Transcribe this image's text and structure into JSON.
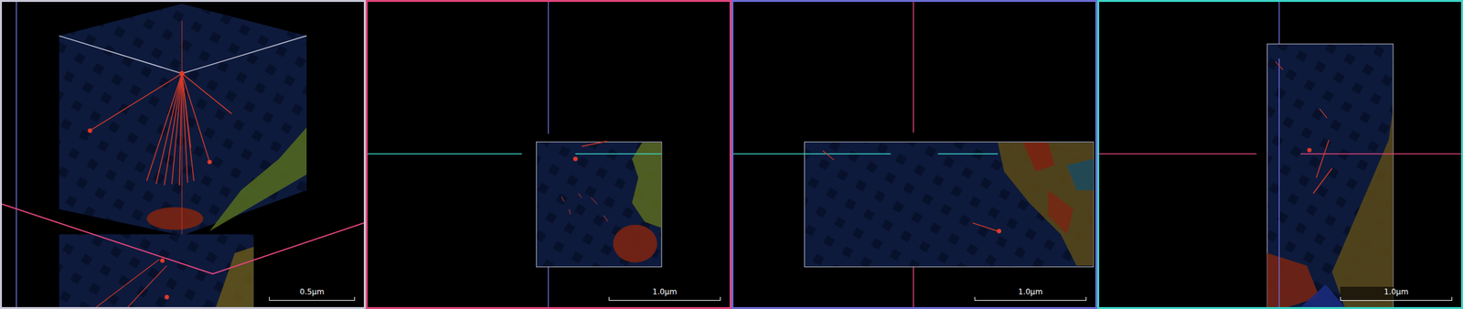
{
  "panels": [
    {
      "kind": "perspective",
      "color": "#c8c8d8",
      "scale": "0.5µm"
    },
    {
      "kind": "xy",
      "color": "#e0457b",
      "scale": "1.0µm"
    },
    {
      "kind": "xz",
      "color": "#6b6bd6",
      "scale": "1.0µm"
    },
    {
      "kind": "yz",
      "color": "#3ad6c6",
      "scale": "1.0µm"
    }
  ]
}
